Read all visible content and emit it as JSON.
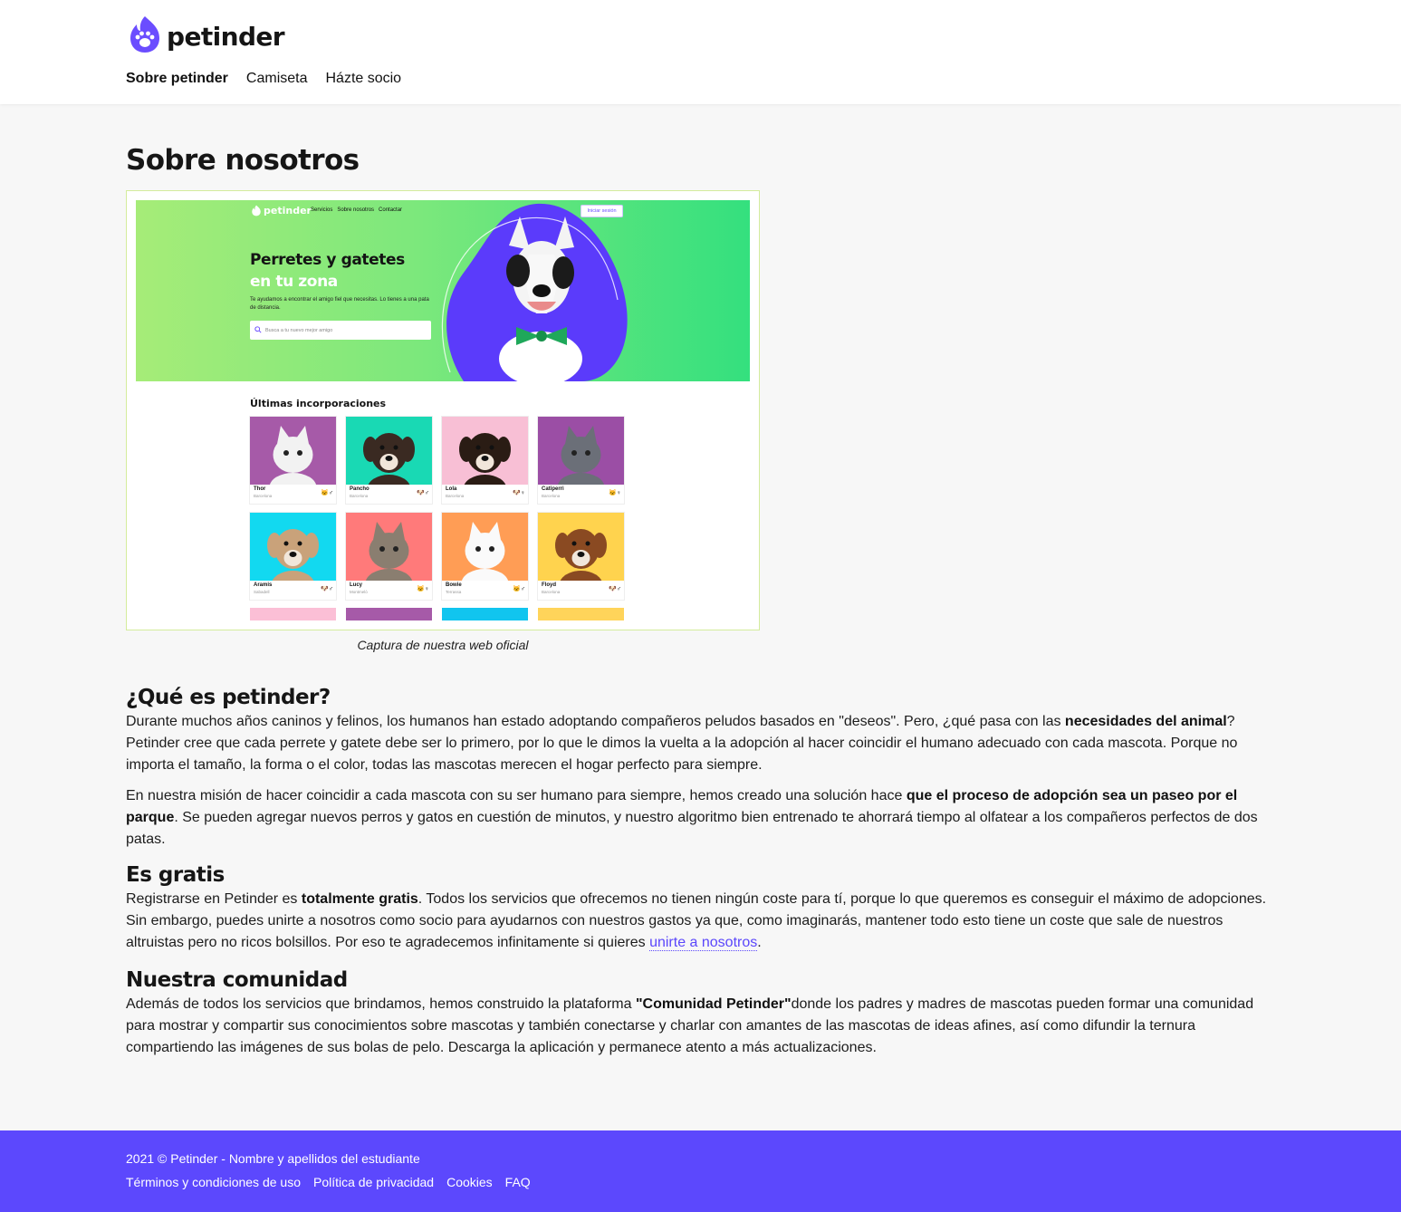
{
  "brand": {
    "name": "petinder",
    "accent": "#5c48fd"
  },
  "nav": {
    "items": [
      "Sobre petinder",
      "Camiseta",
      "Házte socio"
    ]
  },
  "page_title": "Sobre nosotros",
  "screenshot": {
    "logo": "petinder",
    "nav": [
      "Servicios",
      "Sobre nosotros",
      "Contactar"
    ],
    "login": "Iniciar sesión",
    "hero_title_1": "Perretes y gatetes",
    "hero_title_2": "en tu zona",
    "hero_desc": "Te ayudamos a encontrar el amigo fiel que necesitas. Lo tienes a una pata de distancia.",
    "search_placeholder": "Busca a tu nuevo mejor amigo",
    "latest_title": "Últimas incorporaciones",
    "pets": [
      {
        "name": "Thor",
        "city": "Barcelona",
        "icons": "🐱♂",
        "bg": "#a65aa8"
      },
      {
        "name": "Pancho",
        "city": "Barcelona",
        "icons": "🐶♂",
        "bg": "#19d9b4"
      },
      {
        "name": "Lola",
        "city": "Barcelona",
        "icons": "🐶♀",
        "bg": "#f8bfd5"
      },
      {
        "name": "Catiperri",
        "city": "Barcelona",
        "icons": "🐱♀",
        "bg": "#9b4ea5"
      },
      {
        "name": "Aramis",
        "city": "Sabadell",
        "icons": "🐶♂",
        "bg": "#12d9f0"
      },
      {
        "name": "Lucy",
        "city": "Montmeló",
        "icons": "🐱♀",
        "bg": "#ff7a7a"
      },
      {
        "name": "Bowie",
        "city": "Terrassa",
        "icons": "🐱♂",
        "bg": "#ff9d55"
      },
      {
        "name": "Floyd",
        "city": "Barcelona",
        "icons": "🐶♂",
        "bg": "#ffd34e"
      }
    ],
    "strip_colors": [
      "#fbbfd6",
      "#a65aa8",
      "#11c5ef",
      "#ffd45a"
    ],
    "caption": "Captura de nuestra web oficial"
  },
  "sections": {
    "what": {
      "title": "¿Qué es petinder?",
      "p1_a": "Durante muchos años caninos y felinos, los humanos han estado adoptando compañeros peludos basados en \"deseos\". Pero, ¿qué pasa con las ",
      "p1_b": "necesidades del animal",
      "p1_c": "? Petinder cree que cada perrete y gatete debe ser lo primero, por lo que le dimos la vuelta a la adopción al hacer coincidir el humano adecuado con cada mascota. Porque no importa el tamaño, la forma o el color, todas las mascotas merecen el hogar perfecto para siempre.",
      "p2_a": "En nuestra misión de hacer coincidir a cada mascota con su ser humano para siempre, hemos creado una solución hace ",
      "p2_b": "que el proceso de adopción sea un paseo por el parque",
      "p2_c": ". Se pueden agregar nuevos perros y gatos en cuestión de minutos, y nuestro algoritmo bien entrenado te ahorrará tiempo al olfatear a los compañeros perfectos de dos patas."
    },
    "free": {
      "title": "Es gratis",
      "p_a": "Registrarse en Petinder es ",
      "p_b": "totalmente gratis",
      "p_c": ". Todos los servicios que ofrecemos no tienen ningún coste para tí, porque lo que queremos es conseguir el máximo de adopciones. Sin embargo, puedes unirte a nosotros como socio para ayudarnos con nuestros gastos ya que, como imaginarás, mantener todo esto tiene un coste que sale de nuestros altruistas pero no ricos bolsillos. Por eso te agradecemos infinitamente si quieres ",
      "link": "unirte a nosotros",
      "p_d": "."
    },
    "community": {
      "title": "Nuestra comunidad",
      "p_a": "Además de todos los servicios que brindamos, hemos construido la plataforma ",
      "p_b": "\"Comunidad Petinder\"",
      "p_c": "donde los padres y madres de mascotas pueden formar una comunidad para mostrar y compartir sus conocimientos sobre mascotas y también conectarse y charlar con amantes de las mascotas de ideas afines, así como difundir la ternura compartiendo las imágenes de sus bolas de pelo. Descarga la aplicación y permanece atento a más actualizaciones."
    }
  },
  "footer": {
    "copyright": "2021 © Petinder - Nombre y apellidos del estudiante",
    "links": [
      "Términos y condiciones de uso",
      "Política de privacidad",
      "Cookies",
      "FAQ"
    ]
  }
}
